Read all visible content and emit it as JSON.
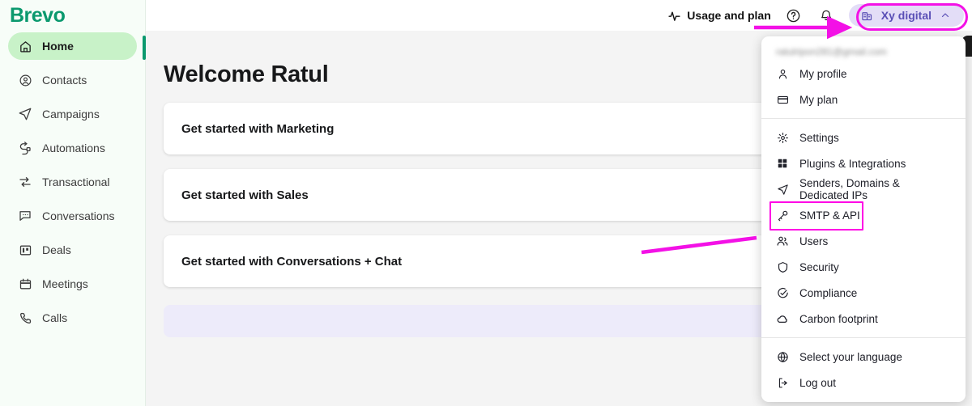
{
  "sidebar": {
    "brand": "Brevo",
    "items": [
      {
        "label": "Home",
        "icon": "home-icon",
        "active": true
      },
      {
        "label": "Contacts",
        "icon": "contacts-icon",
        "active": false
      },
      {
        "label": "Campaigns",
        "icon": "campaigns-send-icon",
        "active": false
      },
      {
        "label": "Automations",
        "icon": "automations-icon",
        "active": false
      },
      {
        "label": "Transactional",
        "icon": "transactional-sync-icon",
        "active": false
      },
      {
        "label": "Conversations",
        "icon": "conversations-chat-icon",
        "active": false
      },
      {
        "label": "Deals",
        "icon": "deals-board-icon",
        "active": false
      },
      {
        "label": "Meetings",
        "icon": "meetings-calendar-icon",
        "active": false
      },
      {
        "label": "Calls",
        "icon": "calls-phone-icon",
        "active": false
      }
    ]
  },
  "topbar": {
    "usage_label": "Usage and plan",
    "usage_icon": "activity-pulse-icon",
    "help_icon": "help-circle-icon",
    "notification_icon": "bell-icon",
    "account_label": "Xy digital",
    "account_icon": "company-building-icon",
    "account_chevron": "chevron-up-icon"
  },
  "main": {
    "page_title": "Welcome Ratul",
    "cards": [
      {
        "label": "Get started with Marketing"
      },
      {
        "label": "Get started with Sales"
      },
      {
        "label": "Get started with Conversations + Chat"
      }
    ]
  },
  "dropdown": {
    "email": "ratulripon281@gmail.com",
    "groups": [
      {
        "items": [
          {
            "label": "My profile",
            "icon": "person-icon",
            "highlight": false
          },
          {
            "label": "My plan",
            "icon": "credit-card-icon",
            "highlight": false
          }
        ]
      },
      {
        "items": [
          {
            "label": "Settings",
            "icon": "gear-icon",
            "highlight": false
          },
          {
            "label": "Plugins & Integrations",
            "icon": "grid-squares-icon",
            "highlight": false
          },
          {
            "label": "Senders, Domains & Dedicated IPs",
            "icon": "send-icon",
            "highlight": false
          },
          {
            "label": "SMTP & API",
            "icon": "key-icon",
            "highlight": true
          },
          {
            "label": "Users",
            "icon": "users-icon",
            "highlight": false
          },
          {
            "label": "Security",
            "icon": "shield-icon",
            "highlight": false
          },
          {
            "label": "Compliance",
            "icon": "check-circle-icon",
            "highlight": false
          },
          {
            "label": "Carbon footprint",
            "icon": "cloud-icon",
            "highlight": false
          }
        ]
      },
      {
        "items": [
          {
            "label": "Select your language",
            "icon": "globe-icon",
            "highlight": false
          },
          {
            "label": "Log out",
            "icon": "logout-icon",
            "highlight": false
          }
        ]
      }
    ]
  },
  "annotations": {
    "accent_color": "#f311e6",
    "box_account_button": "highlight around Xy digital account button",
    "box_smtp_api": "highlight around SMTP & API menu item",
    "arrow_to_account": "arrow pointing right toward account button",
    "arrow_to_smtp": "arrow pointing up-right toward SMTP & API item"
  }
}
